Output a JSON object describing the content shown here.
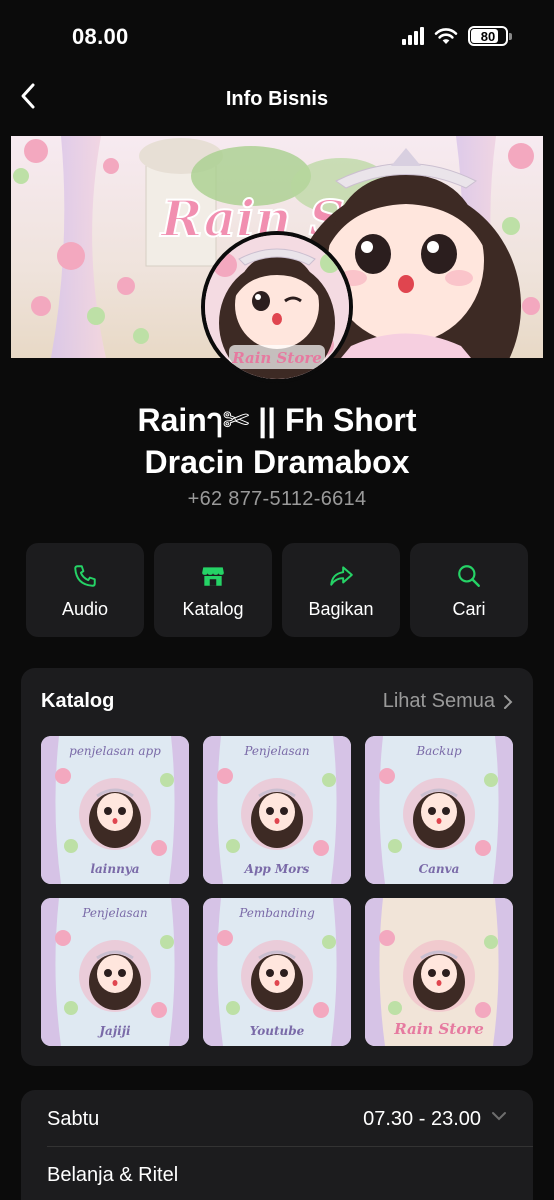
{
  "status": {
    "time": "08.00",
    "battery": "80",
    "battery_level": 0.8
  },
  "nav": {
    "title": "Info Bisnis"
  },
  "profile": {
    "name_line1": "Rainๅ✄ || Fh Short",
    "name_line2": "Dracin Dramabox",
    "phone": "+62 877-5112-6614",
    "banner_text": "Rain Store",
    "avatar_text": "Rain Store"
  },
  "actions": [
    {
      "label": "Audio",
      "icon": "phone-icon"
    },
    {
      "label": "Katalog",
      "icon": "store-icon"
    },
    {
      "label": "Bagikan",
      "icon": "share-icon"
    },
    {
      "label": "Cari",
      "icon": "search-icon"
    }
  ],
  "catalog": {
    "title": "Katalog",
    "see_all": "Lihat Semua",
    "items": [
      {
        "top": "penjelasan app",
        "bottom": "lainnya"
      },
      {
        "top": "Penjelasan",
        "bottom": "App Mors"
      },
      {
        "top": "Backup",
        "bottom": "Canva"
      },
      {
        "top": "Penjelasan",
        "bottom": "Jajiji"
      },
      {
        "top": "Pembanding",
        "bottom": "Youtube"
      },
      {
        "top": "",
        "bottom": "Rain Store"
      }
    ]
  },
  "hours": {
    "day": "Sabtu",
    "time": "07.30 - 23.00"
  },
  "category": "Belanja & Ritel",
  "colors": {
    "accent": "#25d366",
    "card": "#1c1c1e",
    "background": "#0b0b0b",
    "muted": "#9a9a9a"
  }
}
